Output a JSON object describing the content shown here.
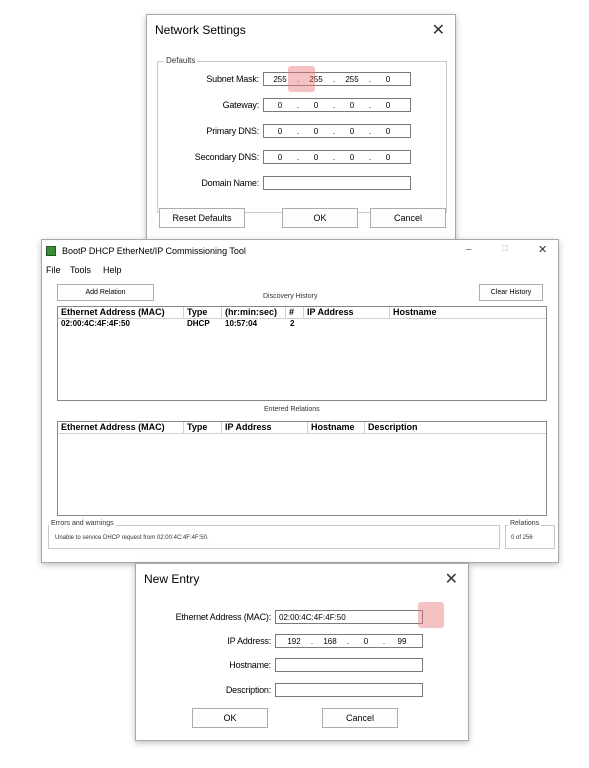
{
  "network_settings": {
    "title": "Network Settings",
    "group_title": "Defaults",
    "subnet_label": "Subnet Mask:",
    "subnet": [
      "255",
      "255",
      "255",
      "0"
    ],
    "gateway_label": "Gateway:",
    "gateway": [
      "0",
      "0",
      "0",
      "0"
    ],
    "primary_dns_label": "Primary DNS:",
    "primary_dns": [
      "0",
      "0",
      "0",
      "0"
    ],
    "secondary_dns_label": "Secondary DNS:",
    "secondary_dns": [
      "0",
      "0",
      "0",
      "0"
    ],
    "domain_label": "Domain Name:",
    "domain_value": "",
    "reset_label": "Reset Defaults",
    "ok_label": "OK",
    "cancel_label": "Cancel",
    "close_glyph": "✕"
  },
  "bootp": {
    "title": "BootP DHCP EtherNet/IP Commissioning Tool",
    "menu": [
      "File",
      "Tools",
      "Help"
    ],
    "minimize_glyph": "–",
    "maximize_glyph": "□",
    "close_glyph": "✕",
    "add_relation_label": "Add Relation",
    "discovery_history_label": "Discovery History",
    "clear_history_label": "Clear History",
    "history_columns": [
      "Ethernet Address (MAC)",
      "Type",
      "(hr:min:sec)",
      "#",
      "IP Address",
      "Hostname"
    ],
    "history_rows": [
      {
        "mac": "02:00:4C:4F:4F:50",
        "type": "DHCP",
        "time": "10:57:04",
        "count": "2",
        "ip": "",
        "hostname": ""
      }
    ],
    "entered_relations_label": "Entered Relations",
    "relation_columns": [
      "Ethernet Address (MAC)",
      "Type",
      "IP Address",
      "Hostname",
      "Description"
    ],
    "errors_label": "Errors and warnings",
    "error_text": "Unable to service DHCP request from 02:00:4C:4F:4F:50.",
    "relations_label": "Relations",
    "relations_count": "0 of 256"
  },
  "new_entry": {
    "title": "New Entry",
    "mac_label": "Ethernet Address (MAC):",
    "mac_value": "02:00:4C:4F:4F:50",
    "ip_label": "IP Address:",
    "ip": [
      "192",
      "168",
      "0",
      "99"
    ],
    "hostname_label": "Hostname:",
    "hostname_value": "",
    "description_label": "Description:",
    "description_value": "",
    "ok_label": "OK",
    "cancel_label": "Cancel",
    "close_glyph": "✕"
  },
  "colors": {
    "highlight": "#e67878",
    "window_border": "#a9a9a9",
    "icon_green": "#3c8c3c"
  }
}
